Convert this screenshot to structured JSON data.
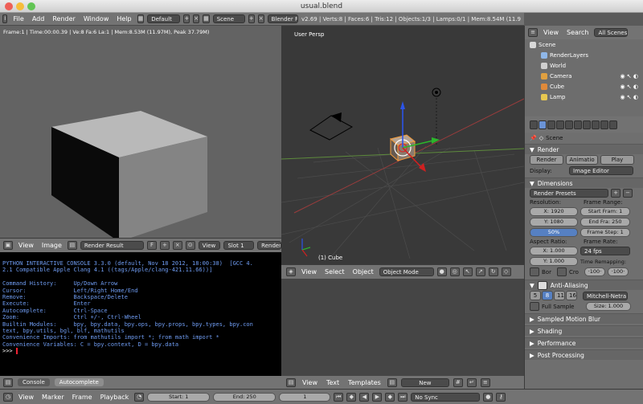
{
  "window": {
    "title": "usual.blend"
  },
  "topbar": {
    "menus": [
      "File",
      "Add",
      "Render",
      "Window",
      "Help"
    ],
    "layout": "Default",
    "scene": "Scene",
    "engine": "Blender Render",
    "stats": "v2.69 | Verts:8 | Faces:6 | Tris:12 | Objects:1/3 | Lamps:0/1 | Mem:8.54M (11.9"
  },
  "render_view": {
    "info": "Frame:1 | Time:00:00.39 | Ve:8 Fa:6 La:1 | Mem:8.53M (11.97M), Peak 37.79M)",
    "header": {
      "view": "View",
      "image": "Image",
      "result": "Render Result",
      "f_label": "F",
      "view2": "View",
      "slot": "Slot 1",
      "render": "Render"
    }
  },
  "console": {
    "lines": [
      "PYTHON INTERACTIVE CONSOLE 3.3.0 (default, Nov 18 2012, 18:00:38)  [GCC 4.",
      "2.1 Compatible Apple Clang 4.1 ((tags/Apple/clang-421.11.66))]",
      "",
      "Command History:     Up/Down Arrow",
      "Cursor:              Left/Right Home/End",
      "Remove:              Backspace/Delete",
      "Execute:             Enter",
      "Autocomplete:        Ctrl-Space",
      "Zoom:                Ctrl +/-, Ctrl-Wheel",
      "Builtin Modules:     bpy, bpy.data, bpy.ops, bpy.props, bpy.types, bpy.con",
      "text, bpy.utils, bgl, blf, mathutils",
      "Convenience Imports: from mathutils import *; from math import *",
      "Convenience Variables: C = bpy.context, D = bpy.data"
    ],
    "prompt": ">>> ",
    "tabs": [
      "Console",
      "Autocomplete"
    ]
  },
  "viewport": {
    "title": "User Persp",
    "object": "(1) Cube",
    "header": {
      "view": "View",
      "select": "Select",
      "object": "Object",
      "mode": "Object Mode"
    }
  },
  "text_editor": {
    "header": {
      "view": "View",
      "text": "Text",
      "templates": "Templates",
      "new": "New"
    }
  },
  "timeline": {
    "view": "View",
    "marker": "Marker",
    "frame": "Frame",
    "playback": "Playback",
    "start": "Start: 1",
    "end": "End: 250",
    "current": "1",
    "sync": "No Sync"
  },
  "outliner": {
    "view": "View",
    "search": "Search",
    "scope": "All Scenes",
    "items": [
      {
        "label": "Scene",
        "color": "#d8d8d8",
        "indent": 0
      },
      {
        "label": "RenderLayers",
        "color": "#8fb7e8",
        "indent": 1
      },
      {
        "label": "World",
        "color": "#cfcfcf",
        "indent": 1
      },
      {
        "label": "Camera",
        "color": "#e0a040",
        "indent": 1
      },
      {
        "label": "Cube",
        "color": "#e08a3a",
        "indent": 1
      },
      {
        "label": "Lamp",
        "color": "#e8c850",
        "indent": 1
      }
    ]
  },
  "properties": {
    "context": "Scene",
    "render": {
      "title": "Render",
      "render_btn": "Render",
      "animation_btn": "Animatio",
      "play_btn": "Play",
      "display_label": "Display:",
      "display_value": "Image Editor"
    },
    "dimensions": {
      "title": "Dimensions",
      "presets": "Render Presets",
      "resolution_label": "Resolution:",
      "frame_range_label": "Frame Range:",
      "res_x": "X: 1920",
      "res_y": "Y: 1080",
      "res_pct": "50%",
      "start_frame": "Start Fram: 1",
      "end_frame": "End Fra: 250",
      "frame_step": "Frame Step: 1",
      "aspect_label": "Aspect Ratio:",
      "frame_rate_label": "Frame Rate:",
      "aspect_x": "X: 1.000",
      "aspect_y": "Y: 1.000",
      "fps": "24 fps",
      "time_remap_label": "Time Remapping:",
      "remap_old": "·100·",
      "remap_new": "·100·",
      "bor": "Bor",
      "cro": "Cro"
    },
    "aa": {
      "title": "Anti-Aliasing",
      "samples": [
        "5",
        "8",
        "11",
        "16"
      ],
      "selected": "8",
      "filter": "Mitchell-Netra",
      "full_sample": "Full Sample",
      "size": "Size: 1.000"
    },
    "collapsed": [
      "Sampled Motion Blur",
      "Shading",
      "Performance",
      "Post Processing"
    ]
  }
}
